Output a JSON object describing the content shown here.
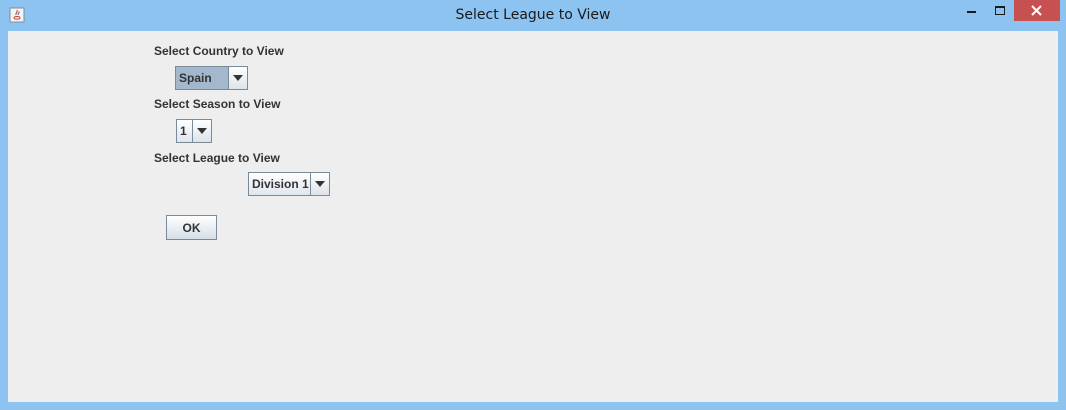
{
  "window": {
    "title": "Select League to View",
    "accent_color": "#8cc3f0",
    "close_color": "#c75050"
  },
  "icons": {
    "app": "java-app-icon",
    "minimize": "minimize-icon",
    "maximize": "maximize-icon",
    "close": "close-icon",
    "dropdown": "chevron-down-icon"
  },
  "form": {
    "country_label": "Select Country to View",
    "country_value": "Spain",
    "season_label": "Select Season to View",
    "season_value": "1",
    "league_label": "Select League to View",
    "league_value": "Division 1",
    "ok_label": "OK"
  }
}
